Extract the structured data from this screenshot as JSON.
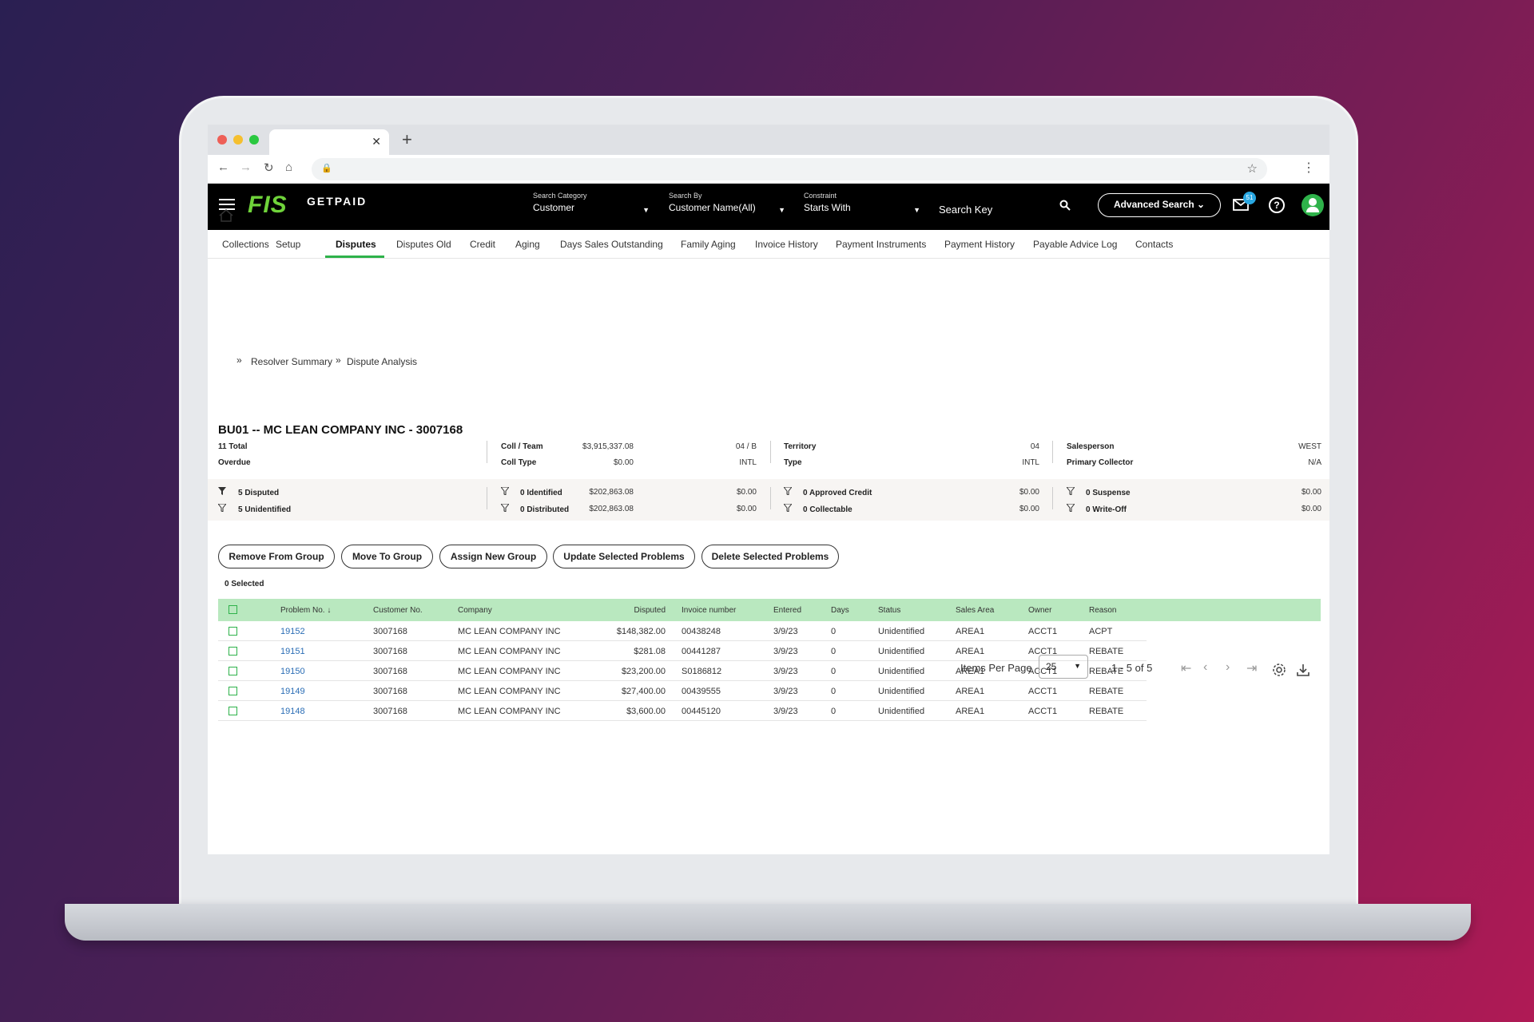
{
  "header": {
    "logo": "FIS",
    "product": "GETPAID",
    "search_category_label": "Search Category",
    "search_category_value": "Customer",
    "search_by_label": "Search By",
    "search_by_value": "Customer Name(All)",
    "constraint_label": "Constraint",
    "constraint_value": "Starts With",
    "search_key_placeholder": "Search Key",
    "advanced_search": "Advanced Search",
    "notifications_count": "51"
  },
  "nav_tabs": [
    "Collections",
    "Setup",
    "Disputes",
    "Disputes Old",
    "Credit",
    "Aging",
    "Days Sales Outstanding",
    "Family Aging",
    "Invoice History",
    "Payment Instruments",
    "Payment History",
    "Payable Advice Log",
    "Contacts"
  ],
  "breadcrumb": {
    "item1": "Resolver Summary",
    "item2": "Dispute Analysis",
    "sep": "»"
  },
  "title": "BU01 -- MC LEAN COMPANY INC - 3007168",
  "summary": {
    "total_label": "11 Total",
    "total_value": "$3,915,337.08",
    "overdue_label": "Overdue",
    "overdue_value": "$0.00",
    "coll_team_label": "Coll / Team",
    "coll_team_value": "04 / B",
    "coll_type_label": "Coll Type",
    "coll_type_value": "INTL",
    "territory_label": "Territory",
    "territory_value": "04",
    "type_label": "Type",
    "type_value": "INTL",
    "salesperson_label": "Salesperson",
    "salesperson_value": "WEST",
    "primary_collector_label": "Primary Collector",
    "primary_collector_value": "N/A"
  },
  "filters": {
    "disputed_label": "5 Disputed",
    "disputed_value": "$202,863.08",
    "unidentified_label": "5 Unidentified",
    "unidentified_value": "$202,863.08",
    "identified_label": "0 Identified",
    "identified_value": "$0.00",
    "distributed_label": "0 Distributed",
    "distributed_value": "$0.00",
    "approved_label": "0 Approved Credit",
    "approved_value": "$0.00",
    "collectable_label": "0 Collectable",
    "collectable_value": "$0.00",
    "suspense_label": "0 Suspense",
    "suspense_value": "$0.00",
    "writeoff_label": "0 Write-Off",
    "writeoff_value": "$0.00"
  },
  "actions": {
    "remove": "Remove From Group",
    "move": "Move To Group",
    "assign": "Assign New Group",
    "update": "Update Selected Problems",
    "delete": "Delete Selected Problems"
  },
  "selected_count": "0 Selected",
  "table": {
    "columns": {
      "problem": "Problem No.",
      "customer": "Customer No.",
      "company": "Company",
      "disputed": "Disputed",
      "invoice": "Invoice number",
      "entered": "Entered",
      "days": "Days",
      "status": "Status",
      "sales_area": "Sales Area",
      "owner": "Owner",
      "reason": "Reason"
    },
    "rows": [
      {
        "problem": "19152",
        "customer": "3007168",
        "company": "MC LEAN COMPANY INC",
        "disputed": "$148,382.00",
        "invoice": "00438248",
        "entered": "3/9/23",
        "days": "0",
        "status": "Unidentified",
        "sales_area": "AREA1",
        "owner": "ACCT1",
        "reason": "ACPT"
      },
      {
        "problem": "19151",
        "customer": "3007168",
        "company": "MC LEAN COMPANY INC",
        "disputed": "$281.08",
        "invoice": "00441287",
        "entered": "3/9/23",
        "days": "0",
        "status": "Unidentified",
        "sales_area": "AREA1",
        "owner": "ACCT1",
        "reason": "REBATE"
      },
      {
        "problem": "19150",
        "customer": "3007168",
        "company": "MC LEAN COMPANY INC",
        "disputed": "$23,200.00",
        "invoice": "S0186812",
        "entered": "3/9/23",
        "days": "0",
        "status": "Unidentified",
        "sales_area": "AREA1",
        "owner": "ACCT1",
        "reason": "REBATE"
      },
      {
        "problem": "19149",
        "customer": "3007168",
        "company": "MC LEAN COMPANY INC",
        "disputed": "$27,400.00",
        "invoice": "00439555",
        "entered": "3/9/23",
        "days": "0",
        "status": "Unidentified",
        "sales_area": "AREA1",
        "owner": "ACCT1",
        "reason": "REBATE"
      },
      {
        "problem": "19148",
        "customer": "3007168",
        "company": "MC LEAN COMPANY INC",
        "disputed": "$3,600.00",
        "invoice": "00445120",
        "entered": "3/9/23",
        "days": "0",
        "status": "Unidentified",
        "sales_area": "AREA1",
        "owner": "ACCT1",
        "reason": "REBATE"
      }
    ]
  },
  "pagination": {
    "items_per_page_label": "Items Per Page",
    "items_per_page": "25",
    "range": "1 - 5 of 5"
  },
  "colors": {
    "brand_green": "#6fd33a",
    "accent_green": "#2eb24a",
    "header_row": "#b9e8bf",
    "link": "#2a6db5"
  }
}
